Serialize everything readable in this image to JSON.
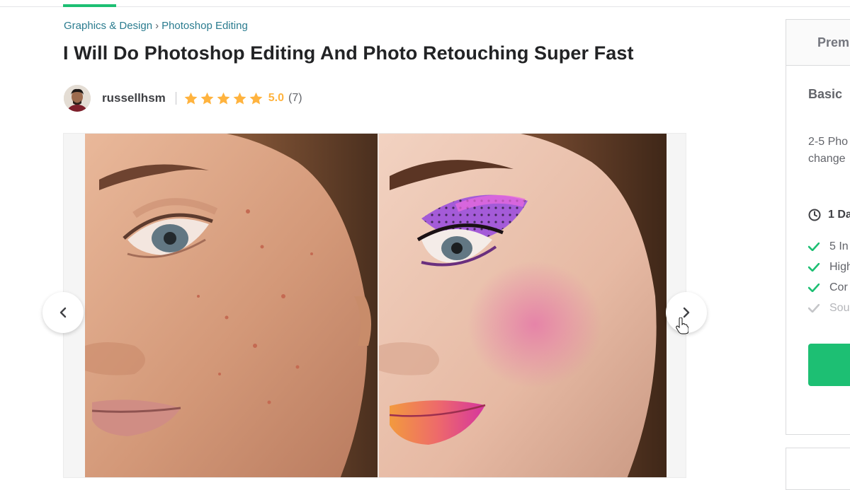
{
  "breadcrumb": {
    "category": "Graphics & Design",
    "separator": "›",
    "subcategory": "Photoshop Editing"
  },
  "gig": {
    "title": "I Will Do Photoshop Editing And Photo Retouching Super Fast"
  },
  "seller": {
    "username": "russellhsm",
    "stars": 5,
    "rating": "5.0",
    "review_count": "(7)"
  },
  "gallery": {
    "left_image": "before-retouch-portrait",
    "right_image": "after-retouch-portrait"
  },
  "package_panel": {
    "tab_label": "Prem",
    "package_name": "Basic",
    "description_line1": "2-5 Pho",
    "description_line2": "change",
    "delivery": "1 Da",
    "features": [
      {
        "label": "5 In",
        "included": true
      },
      {
        "label": "High",
        "included": true
      },
      {
        "label": "Cor",
        "included": true
      },
      {
        "label": "Sou",
        "included": false
      }
    ]
  },
  "colors": {
    "brand_green": "#1dbf73",
    "star_yellow": "#ffb33e",
    "breadcrumb_link": "#2b7c8f"
  }
}
